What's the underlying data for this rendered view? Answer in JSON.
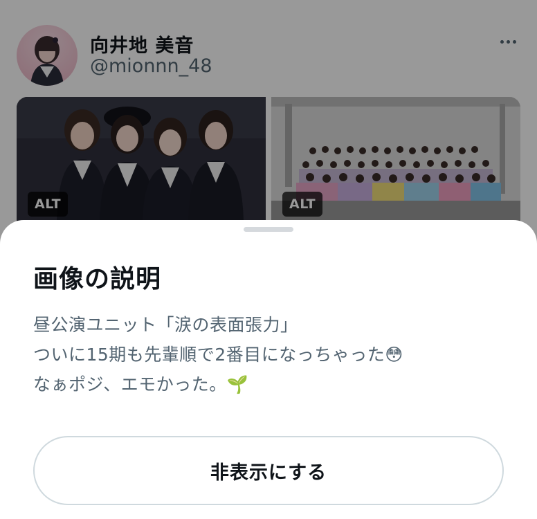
{
  "tweet": {
    "display_name": "向井地 美音",
    "handle": "@mionnn_48",
    "more_icon": "more-horizontal-icon",
    "media": [
      {
        "alt_badge": "ALT"
      },
      {
        "alt_badge": "ALT"
      }
    ]
  },
  "sheet": {
    "title": "画像の説明",
    "description_lines": [
      "昼公演ユニット「涙の表面張力」",
      "ついに15期も先輩順で2番目になっちゃった😳",
      "なぁポジ、エモかった。🌱"
    ],
    "hide_button_label": "非表示にする"
  },
  "colors": {
    "overlay": "rgba(0,0,0,0.40)",
    "text_primary": "#0f1419",
    "text_secondary": "#536471",
    "button_border": "#cfd9de"
  }
}
